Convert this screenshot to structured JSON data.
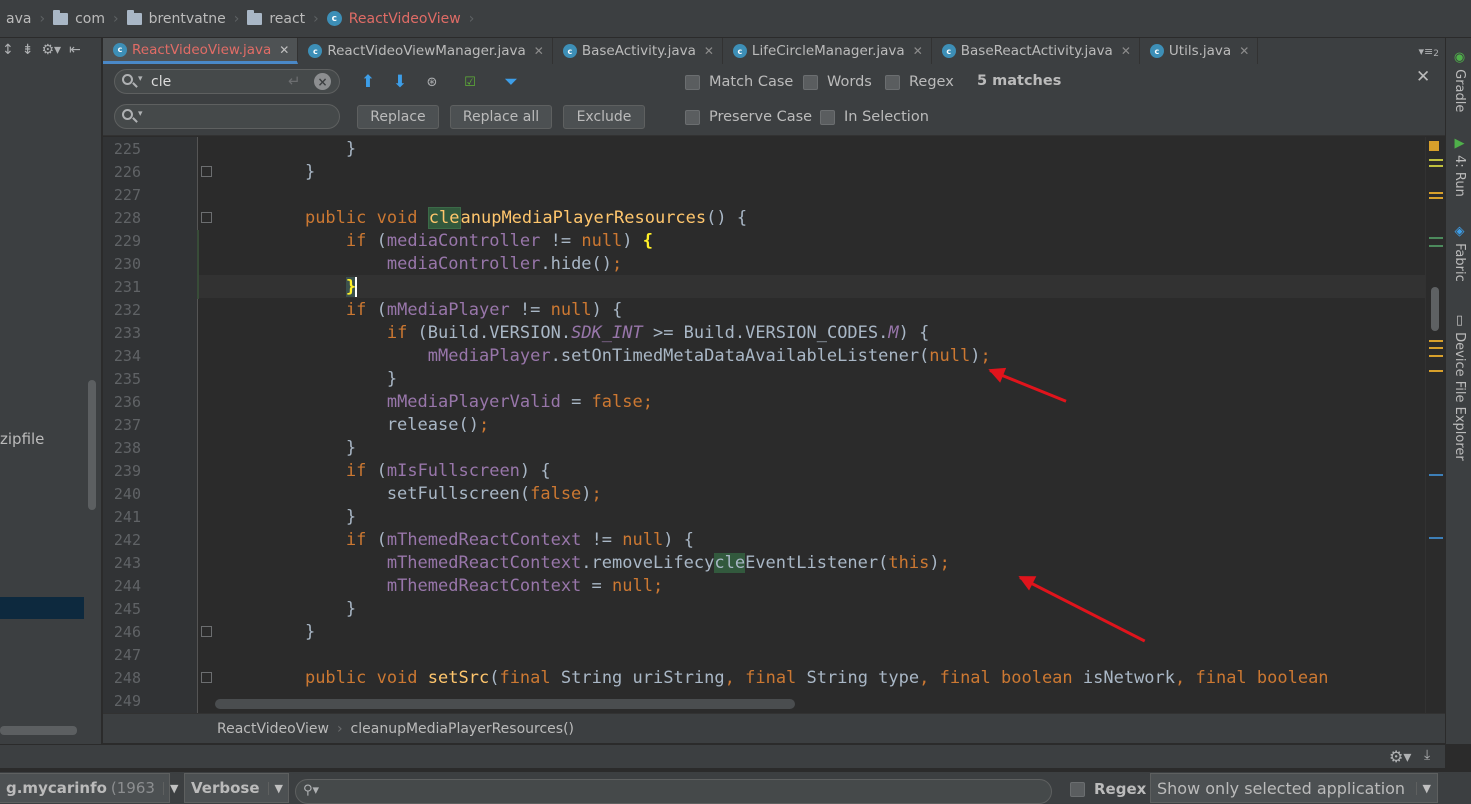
{
  "breadcrumb": {
    "items": [
      "ava",
      "com",
      "brentvatne",
      "react",
      "ReactVideoView"
    ]
  },
  "left_panel": {
    "visible_item": "zipfile"
  },
  "tabs": [
    {
      "label": "ReactVideoView.java",
      "active": true
    },
    {
      "label": "ReactVideoViewManager.java",
      "active": false
    },
    {
      "label": "BaseActivity.java",
      "active": false
    },
    {
      "label": "LifeCircleManager.java",
      "active": false
    },
    {
      "label": "BaseReactActivity.java",
      "active": false
    },
    {
      "label": "Utils.java",
      "active": false
    }
  ],
  "tab_overflow": "2",
  "find": {
    "search_value": "cle",
    "replace_value": "",
    "replace_label": "Replace",
    "replace_all_label": "Replace all",
    "exclude_label": "Exclude",
    "match_case_label": "Match Case",
    "words_label": "Words",
    "regex_label": "Regex",
    "preserve_case_label": "Preserve Case",
    "in_selection_label": "In Selection",
    "matches_label": "5 matches"
  },
  "editor": {
    "line_numbers": [
      "225",
      "226",
      "227",
      "228",
      "229",
      "230",
      "231",
      "232",
      "233",
      "234",
      "235",
      "236",
      "237",
      "238",
      "239",
      "240",
      "241",
      "242",
      "243",
      "244",
      "245",
      "246",
      "247",
      "248",
      "249"
    ]
  },
  "right_tools": [
    "Gradle",
    "4: Run",
    "Fabric",
    "Device File Explorer"
  ],
  "editor_breadcrumb": [
    "ReactVideoView",
    "cleanupMediaPlayerResources()"
  ],
  "logcat": {
    "process": "g.mycarinfo",
    "process_pid": "(1963",
    "level": "Verbose",
    "regex_label": "Regex",
    "filter": "Show only selected application"
  },
  "colors": {
    "keyword": "#cc7832",
    "field": "#9876aa",
    "method_decl": "#ffc66d",
    "annotation_arrow": "#e0141c",
    "match_highlight": "#32593d"
  }
}
